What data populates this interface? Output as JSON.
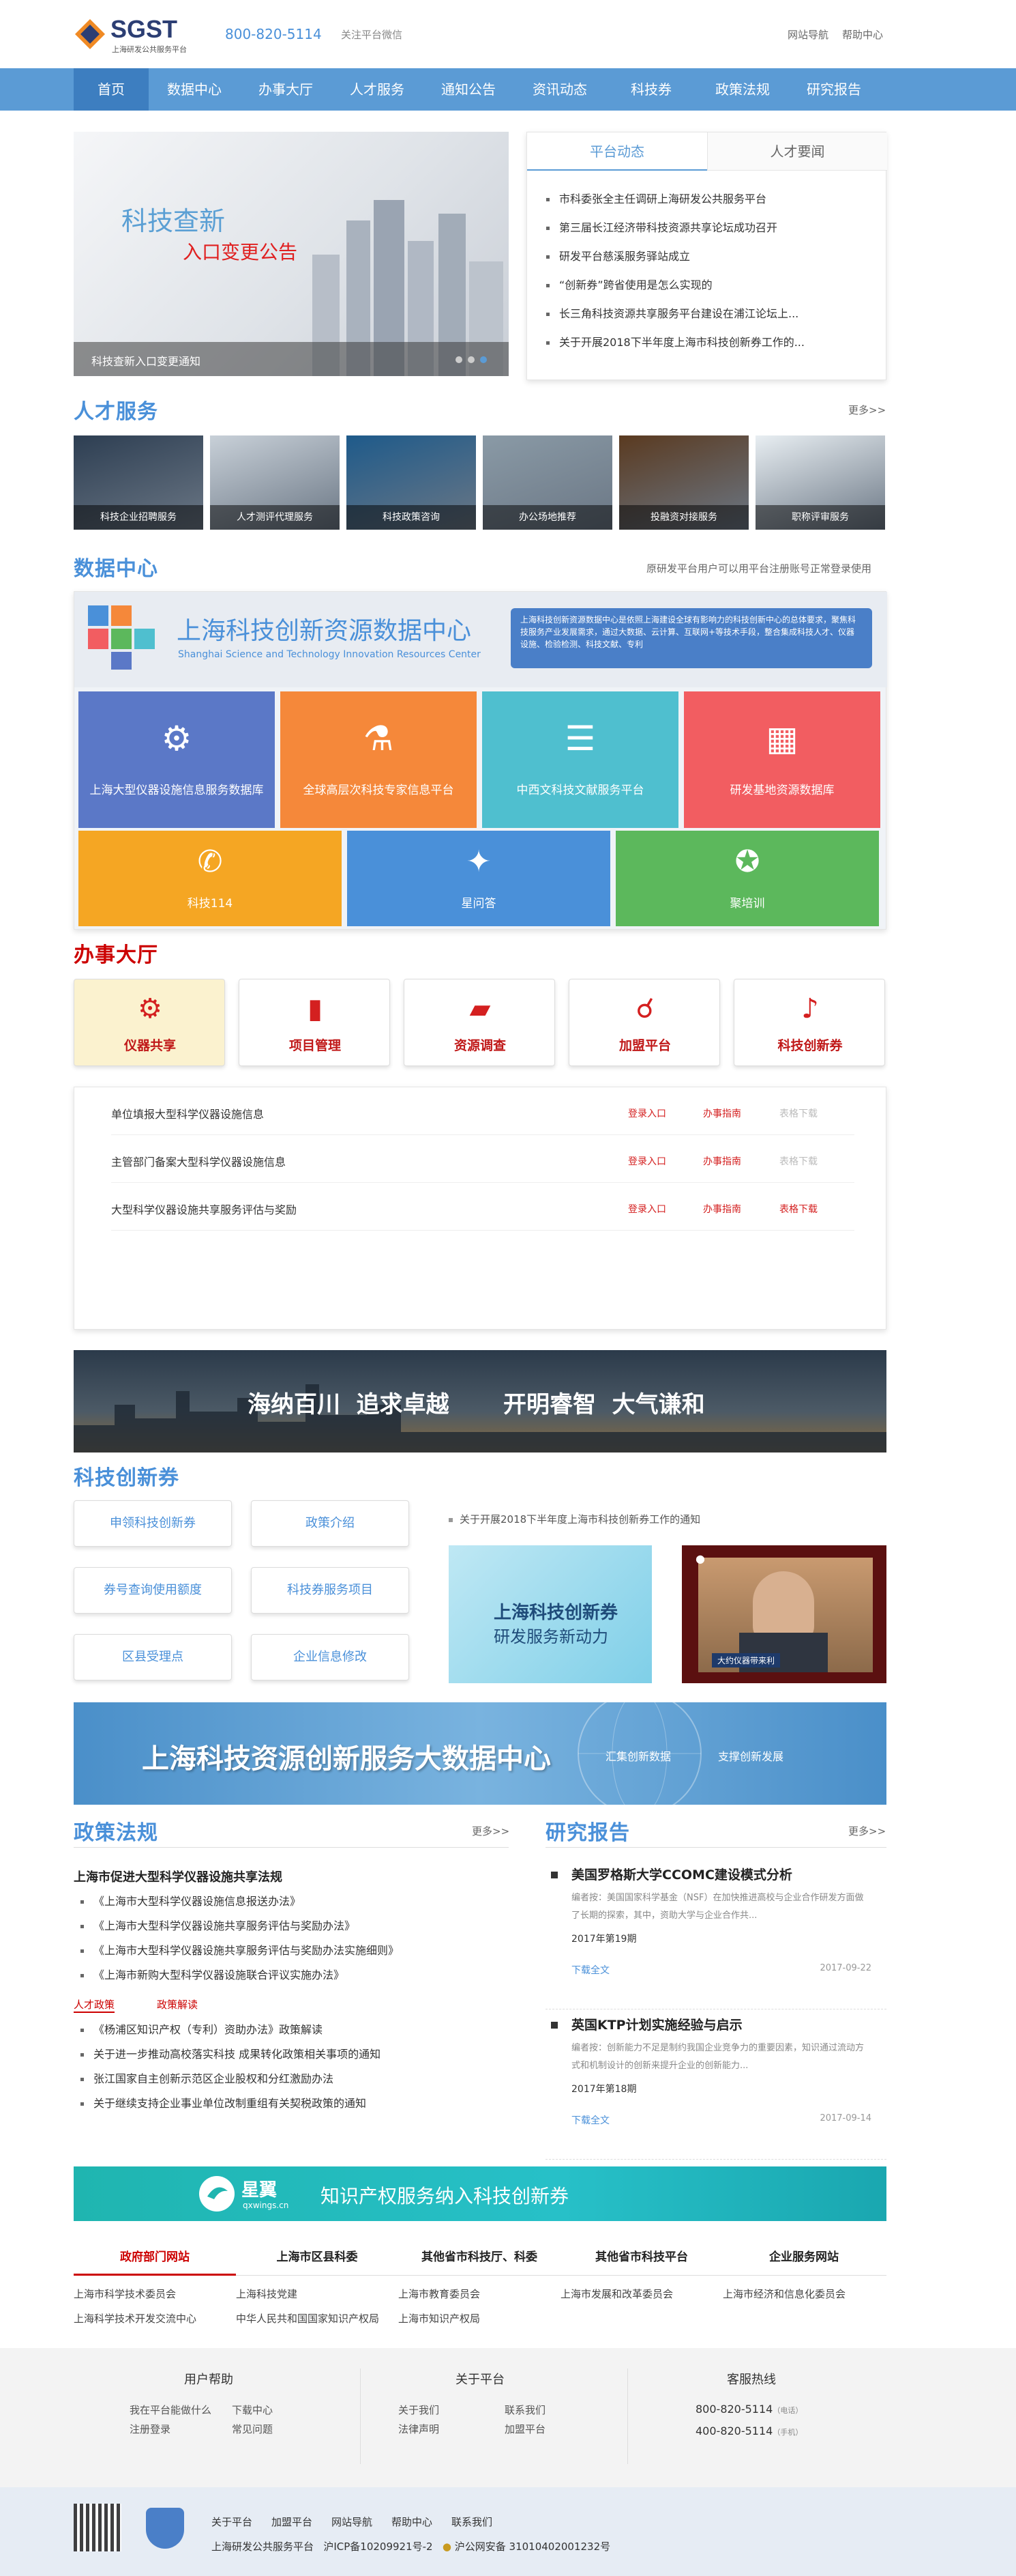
{
  "header": {
    "logo_text": "SGST",
    "logo_sub": "上海研发公共服务平台",
    "phone": "800-820-5114",
    "wechat": "关注平台微信",
    "links": [
      "网站导航",
      "帮助中心"
    ]
  },
  "nav": {
    "items": [
      "首页",
      "数据中心",
      "办事大厅",
      "人才服务",
      "通知公告",
      "资讯动态",
      "科技券",
      "政策法规",
      "研究报告"
    ],
    "active": 0
  },
  "banner": {
    "title1": "科技查新",
    "title2": "入口变更公告",
    "caption": "科技查新入口变更通知"
  },
  "news": {
    "tabs": [
      "平台动态",
      "人才要闻"
    ],
    "items": [
      "市科委张全主任调研上海研发公共服务平台",
      "第三届长江经济带科技资源共享论坛成功召开",
      "研发平台慈溪服务驿站成立",
      "“创新券”跨省使用是怎么实现的",
      "长三角科技资源共享服务平台建设在浦江论坛上...",
      "关于开展2018下半年度上海市科技创新券工作的..."
    ]
  },
  "talent": {
    "title": "人才服务",
    "more": "更多>>",
    "items": [
      "科技企业招聘服务",
      "人才测评代理服务",
      "科技政策咨询",
      "办公场地推荐",
      "投融资对接服务",
      "职称评审服务"
    ]
  },
  "data_center": {
    "title": "数据中心",
    "note": "原研发平台用户可以用平台注册账号正常登录使用",
    "banner_cn": "上海科技创新资源数据中心",
    "banner_en": "Shanghai Science and Technology Innovation Resources Center",
    "banner_desc": "上海科技创新资源数据中心是依照上海建设全球有影响力的科技创新中心的总体要求，聚焦科技服务产业发展需求，通过大数据、云计算、互联网+等技术手段，整合集成科技人才、仪器设施、检验检测、科技文献、专利",
    "tiles1": [
      "上海大型仪器设施信息服务数据库",
      "全球高层次科技专家信息平台",
      "中西文科技文献服务平台",
      "研发基地资源数据库"
    ],
    "tiles2": [
      "科技114",
      "星问答",
      "聚培训"
    ],
    "colors1": [
      "#5b78c7",
      "#f5883a",
      "#4fbfcf",
      "#f25d61"
    ],
    "colors2": [
      "#f5a623",
      "#4a90d9",
      "#5cb85c"
    ]
  },
  "hall": {
    "title": "办事大厅",
    "buttons": [
      "仪器共享",
      "项目管理",
      "资源调查",
      "加盟平台",
      "科技创新券"
    ],
    "rows": [
      {
        "name": "单位填报大型科学仪器设施信息",
        "a": "登录入口",
        "b": "办事指南",
        "c": "表格下载",
        "c_active": false
      },
      {
        "name": "主管部门备案大型科学仪器设施信息",
        "a": "登录入口",
        "b": "办事指南",
        "c": "表格下载",
        "c_active": false
      },
      {
        "name": "大型科学仪器设施共享服务评估与奖励",
        "a": "登录入口",
        "b": "办事指南",
        "c": "表格下载",
        "c_active": true
      }
    ]
  },
  "slogan": {
    "a": "海纳百川  追求卓越",
    "b": "开明睿智  大气谦和"
  },
  "voucher": {
    "title": "科技创新券",
    "buttons": [
      "申领科技创新券",
      "政策介绍",
      "券号查询使用额度",
      "科技券服务项目",
      "区县受理点",
      "企业信息修改"
    ],
    "notice": "关于开展2018下半年度上海市科技创新券工作的通知",
    "img_text1": "上海科技创新券",
    "img_text2": "研发服务新动力",
    "video_caption": "大约仪器带来利"
  },
  "bigdata": {
    "title": "上海科技资源创新服务大数据中心",
    "sub1": "汇集创新数据",
    "sub2": "支撑创新发展"
  },
  "policy": {
    "title": "政策法规",
    "more": "更多>>",
    "head": "上海市促进大型科学仪器设施共享法规",
    "list1": [
      "《上海市大型科学仪器设施信息报送办法》",
      "《上海市大型科学仪器设施共享服务评估与奖励办法》",
      "《上海市大型科学仪器设施共享服务评估与奖励办法实施细则》",
      "《上海市新购大型科学仪器设施联合评议实施办法》"
    ],
    "tabs": [
      "人才政策",
      "政策解读"
    ],
    "list2": [
      "《杨浦区知识产权（专利）资助办法》政策解读",
      "关于进一步推动高校落实科技 成果转化政策相关事项的通知",
      "张江国家自主创新示范区企业股权和分红激励办法",
      "关于继续支持企业事业单位改制重组有关契税政策的通知"
    ]
  },
  "report": {
    "title": "研究报告",
    "more": "更多>>",
    "items": [
      {
        "title": "美国罗格斯大学CCOMC建设模式分析",
        "desc": "编者按：美国国家科学基金（NSF）在加快推进高校与企业合作研发方面做了长期的探索，其中，资助大学与企业合作共...",
        "issue": "2017年第19期",
        "dl": "下载全文",
        "date": "2017-09-22"
      },
      {
        "title": "英国KTP计划实施经验与启示",
        "desc": "编者按：创新能力不足是制约我国企业竞争力的重要因素，知识通过流动方式和机制设计的创新来提升企业的创新能力...",
        "issue": "2017年第18期",
        "dl": "下载全文",
        "date": "2017-09-14"
      }
    ]
  },
  "ip_banner": {
    "brand": "星翼",
    "brand_url": "qxwings.cn",
    "text": "知识产权服务纳入科技创新券"
  },
  "links": {
    "tabs": [
      "政府部门网站",
      "上海市区县科委",
      "其他省市科技厅、科委",
      "其他省市科技平台",
      "企业服务网站"
    ],
    "row1": [
      "上海市科学技术委员会",
      "上海科技党建",
      "上海市教育委员会",
      "上海市发展和改革委员会",
      "上海市经济和信息化委员会"
    ],
    "row2": [
      "上海科学技术开发交流中心",
      "中华人民共和国国家知识产权局",
      "上海市知识产权局"
    ]
  },
  "footer": {
    "help_title": "用户帮助",
    "help": [
      "我在平台能做什么",
      "下载中心",
      "注册登录",
      "常见问题"
    ],
    "about_title": "关于平台",
    "about": [
      "关于我们",
      "联系我们",
      "法律声明",
      "加盟平台"
    ],
    "hotline_title": "客服热线",
    "hot1": "800-820-5114",
    "hot1_note": "（电话）",
    "hot2": "400-820-5114",
    "hot2_note": "（手机）",
    "bottom_links": [
      "关于平台",
      "加盟平台",
      "网站导航",
      "帮助中心",
      "联系我们"
    ],
    "copyright": "上海研发公共服务平台",
    "icp": "沪ICP备10209921号-2",
    "police": "沪公网安备 31010402001232号"
  }
}
